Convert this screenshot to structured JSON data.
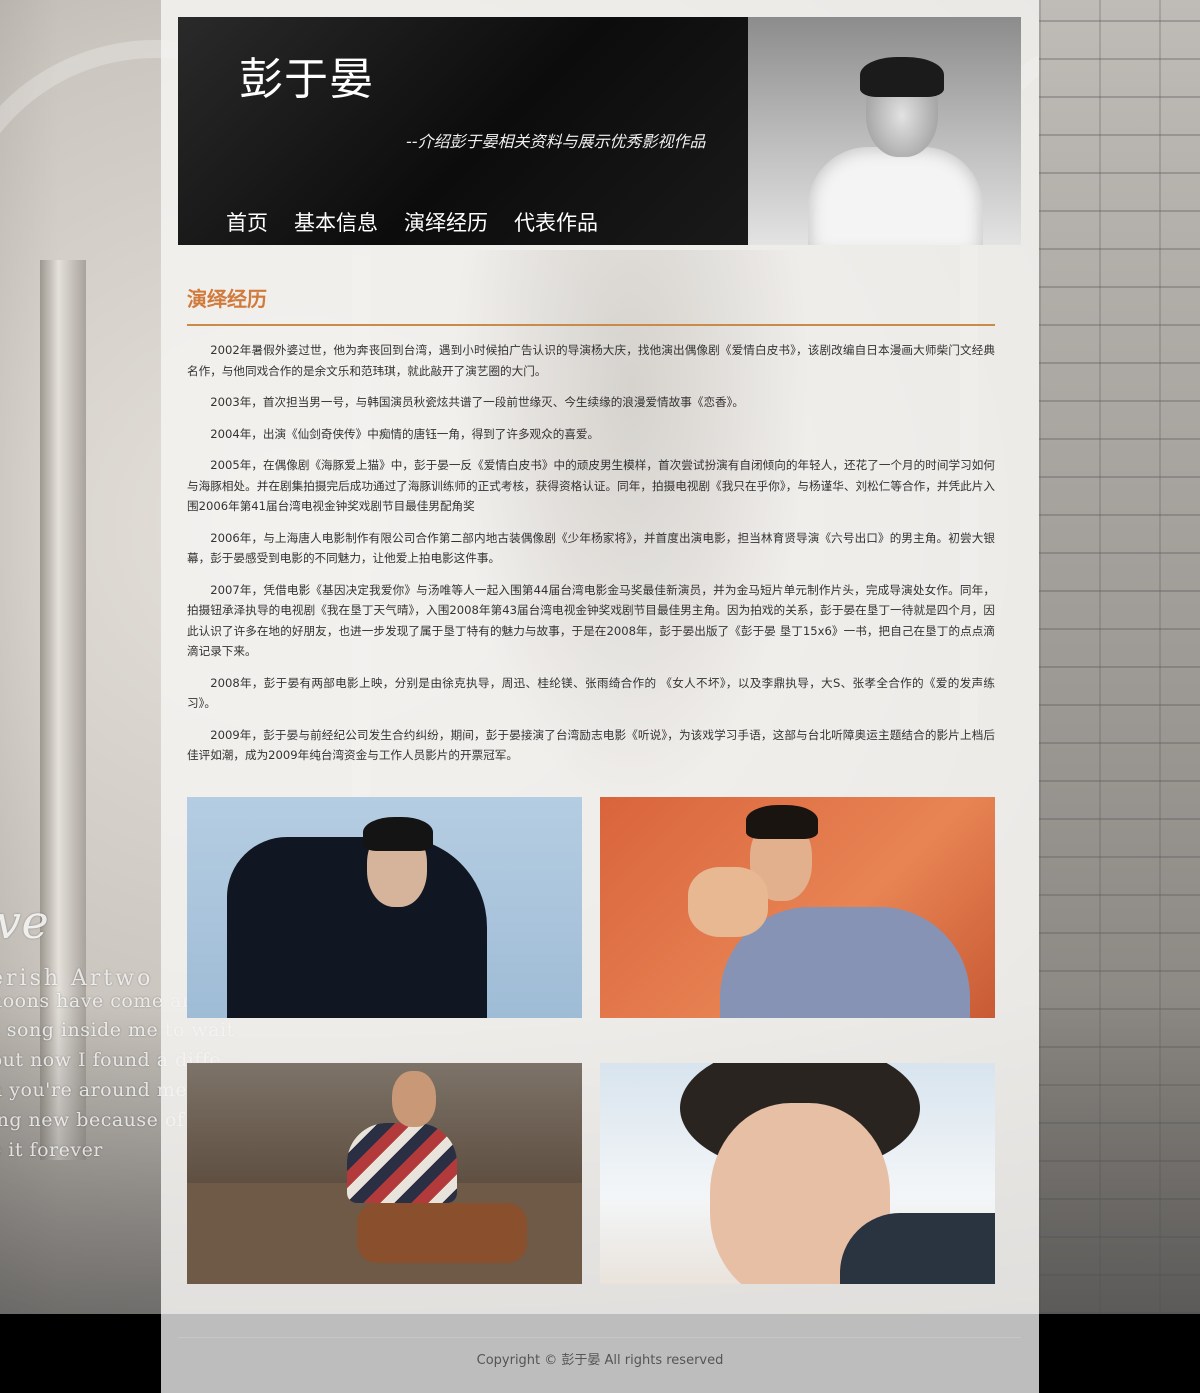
{
  "background": {
    "script_word": "ve",
    "lines": [
      "erish Artwo",
      "hoons have come and g",
      "s song inside me to wait",
      "but now I found a diffe",
      "n you're around me",
      "ing new because of yo",
      "e it forever"
    ]
  },
  "header": {
    "title": "彭于晏",
    "subtitle": "--介绍彭于晏相关资料与展示优秀影视作品",
    "nav": [
      "首页",
      "基本信息",
      "演绎经历",
      "代表作品"
    ]
  },
  "section": {
    "title": "演绎经历",
    "paragraphs": [
      "2002年暑假外婆过世，他为奔丧回到台湾，遇到小时候拍广告认识的导演杨大庆，找他演出偶像剧《爱情白皮书》，该剧改编自日本漫画大师柴门文经典名作，与他同戏合作的是余文乐和范玮琪，就此敲开了演艺圈的大门。",
      "2003年，首次担当男一号，与韩国演员秋瓷炫共谱了一段前世缘灭、今生续缘的浪漫爱情故事《恋香》。",
      "2004年，出演《仙剑奇侠传》中痴情的唐钰一角，得到了许多观众的喜爱。",
      "2005年，在偶像剧《海豚爱上猫》中，彭于晏一反《爱情白皮书》中的顽皮男生模样，首次尝试扮演有自闭倾向的年轻人，还花了一个月的时间学习如何与海豚相处。并在剧集拍摄完后成功通过了海豚训练师的正式考核，获得资格认证。同年，拍摄电视剧《我只在乎你》，与杨谨华、刘松仁等合作，并凭此片入围2006年第41届台湾电视金钟奖戏剧节目最佳男配角奖",
      "2006年，与上海唐人电影制作有限公司合作第二部内地古装偶像剧《少年杨家将》，并首度出演电影，担当林育贤导演《六号出口》的男主角。初尝大银幕，彭于晏感受到电影的不同魅力，让他爱上拍电影这件事。",
      "2007年，凭借电影《基因决定我爱你》与汤唯等人一起入围第44届台湾电影金马奖最佳新演员，并为金马短片单元制作片头，完成导演处女作。同年，拍摄钮承泽执导的电视剧《我在垦丁天气晴》，入围2008年第43届台湾电视金钟奖戏剧节目最佳男主角。因为拍戏的关系，彭于晏在垦丁一待就是四个月，因此认识了许多在地的好朋友，也进一步发现了属于垦丁特有的魅力与故事，于是在2008年，彭于晏出版了《彭于晏 垦丁15x6》一书，把自己在垦丁的点点滴滴记录下来。",
      "2008年，彭于晏有两部电影上映，分别是由徐克执导，周迅、桂纶镁、张雨绮合作的 《女人不坏》，以及李鼎执导，大S、张孝全合作的《爱的发声练习》。",
      "2009年，彭于晏与前经纪公司发生合约纠纷，期间，彭于晏接演了台湾励志电影《听说》，为该戏学习手语，这部与台北听障奥运主题结合的影片上档后佳评如潮，成为2009年纯台湾资金与工作人员影片的开票冠军。"
    ]
  },
  "footer": {
    "copyright": "Copyright © 彭于晏 All rights reserved"
  },
  "colors": {
    "accent": "#d07a3c",
    "rule": "#c88b4a",
    "header_bg": "#111111"
  }
}
